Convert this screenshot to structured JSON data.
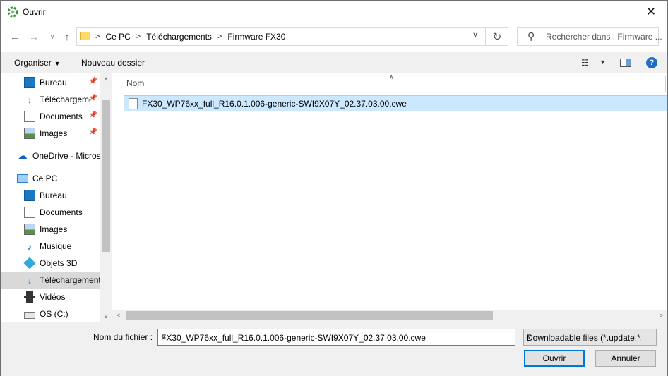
{
  "window": {
    "title": "Ouvrir",
    "close_glyph": "✕"
  },
  "address": {
    "crumbs": [
      "Ce PC",
      "Téléchargements",
      "Firmware FX30"
    ],
    "separator": ">"
  },
  "search": {
    "placeholder": "Rechercher dans : Firmware ..."
  },
  "toolbar": {
    "organize_label": "Organiser",
    "new_folder_label": "Nouveau dossier",
    "help_glyph": "?"
  },
  "nav": {
    "items": [
      {
        "label": "Bureau",
        "icon": "desktop-icon",
        "pinned": true
      },
      {
        "label": "Téléchargements",
        "icon": "downloads-icon",
        "pinned": true
      },
      {
        "label": "Documents",
        "icon": "documents-icon",
        "pinned": true
      },
      {
        "label": "Images",
        "icon": "pictures-icon",
        "pinned": true
      },
      {
        "label": "OneDrive - Microsoft",
        "icon": "onedrive-icon",
        "pinned": false
      },
      {
        "label": "Ce PC",
        "icon": "this-pc-icon",
        "pinned": false
      },
      {
        "label": "Bureau",
        "icon": "desktop-icon",
        "pinned": false
      },
      {
        "label": "Documents",
        "icon": "documents-icon",
        "pinned": false
      },
      {
        "label": "Images",
        "icon": "pictures-icon",
        "pinned": false
      },
      {
        "label": "Musique",
        "icon": "music-icon",
        "pinned": false
      },
      {
        "label": "Objets 3D",
        "icon": "3d-objects-icon",
        "pinned": false
      },
      {
        "label": "Téléchargements",
        "icon": "downloads-icon",
        "pinned": false,
        "selected": true
      },
      {
        "label": "Vidéos",
        "icon": "videos-icon",
        "pinned": false
      },
      {
        "label": "OS (C:)",
        "icon": "drive-icon",
        "pinned": false
      }
    ]
  },
  "list": {
    "column_name": "Nom",
    "files": [
      {
        "name": "FX30_WP76xx_full_R16.0.1.006-generic-SWI9X07Y_02.37.03.00.cwe",
        "selected": true
      }
    ]
  },
  "footer": {
    "filename_label": "Nom du fichier :",
    "filename_value": "FX30_WP76xx_full_R16.0.1.006-generic-SWI9X07Y_02.37.03.00.cwe",
    "filter_value": "Downloadable files (*.update;*.cwe)",
    "open_label": "Ouvrir",
    "cancel_label": "Annuler"
  }
}
